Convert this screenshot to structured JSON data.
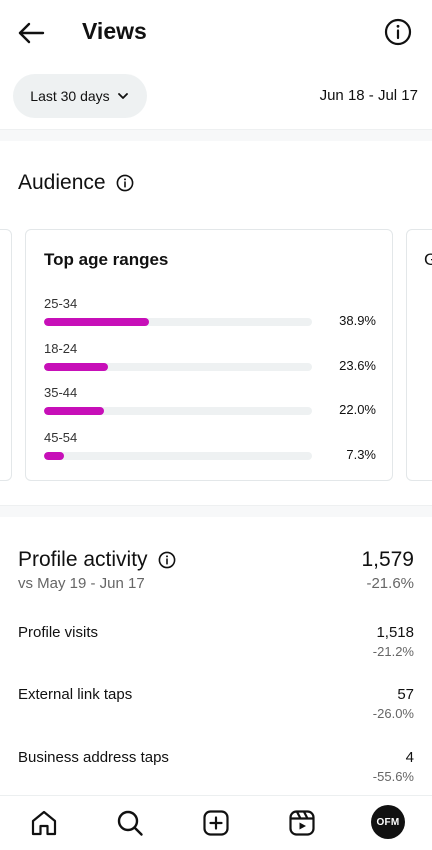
{
  "header": {
    "title": "Views",
    "back_icon": "arrow-left-icon",
    "info_icon": "info-icon"
  },
  "filters": {
    "range_label": "Last 30 days",
    "date_range": "Jun 18 - Jul 17"
  },
  "audience": {
    "title": "Audience",
    "card_title": "Top age ranges",
    "next_card_initial": "G",
    "accent_color": "#c70fb8",
    "age_ranges": [
      {
        "label": "25-34",
        "percent_text": "38.9%",
        "fill": 0.389
      },
      {
        "label": "18-24",
        "percent_text": "23.6%",
        "fill": 0.236
      },
      {
        "label": "35-44",
        "percent_text": "22.0%",
        "fill": 0.22
      },
      {
        "label": "45-54",
        "percent_text": "7.3%",
        "fill": 0.073
      }
    ]
  },
  "profile_activity": {
    "title": "Profile activity",
    "comparison": "vs May 19 - Jun 17",
    "total": "1,579",
    "total_change": "-21.6%",
    "metrics": [
      {
        "label": "Profile visits",
        "value": "1,518",
        "change": "-21.2%"
      },
      {
        "label": "External link taps",
        "value": "57",
        "change": "-26.0%"
      },
      {
        "label": "Business address taps",
        "value": "4",
        "change": "-55.6%"
      }
    ]
  },
  "bottom_nav": {
    "items": [
      "home-icon",
      "search-icon",
      "create-icon",
      "reels-icon"
    ],
    "avatar_text": "OFM"
  }
}
